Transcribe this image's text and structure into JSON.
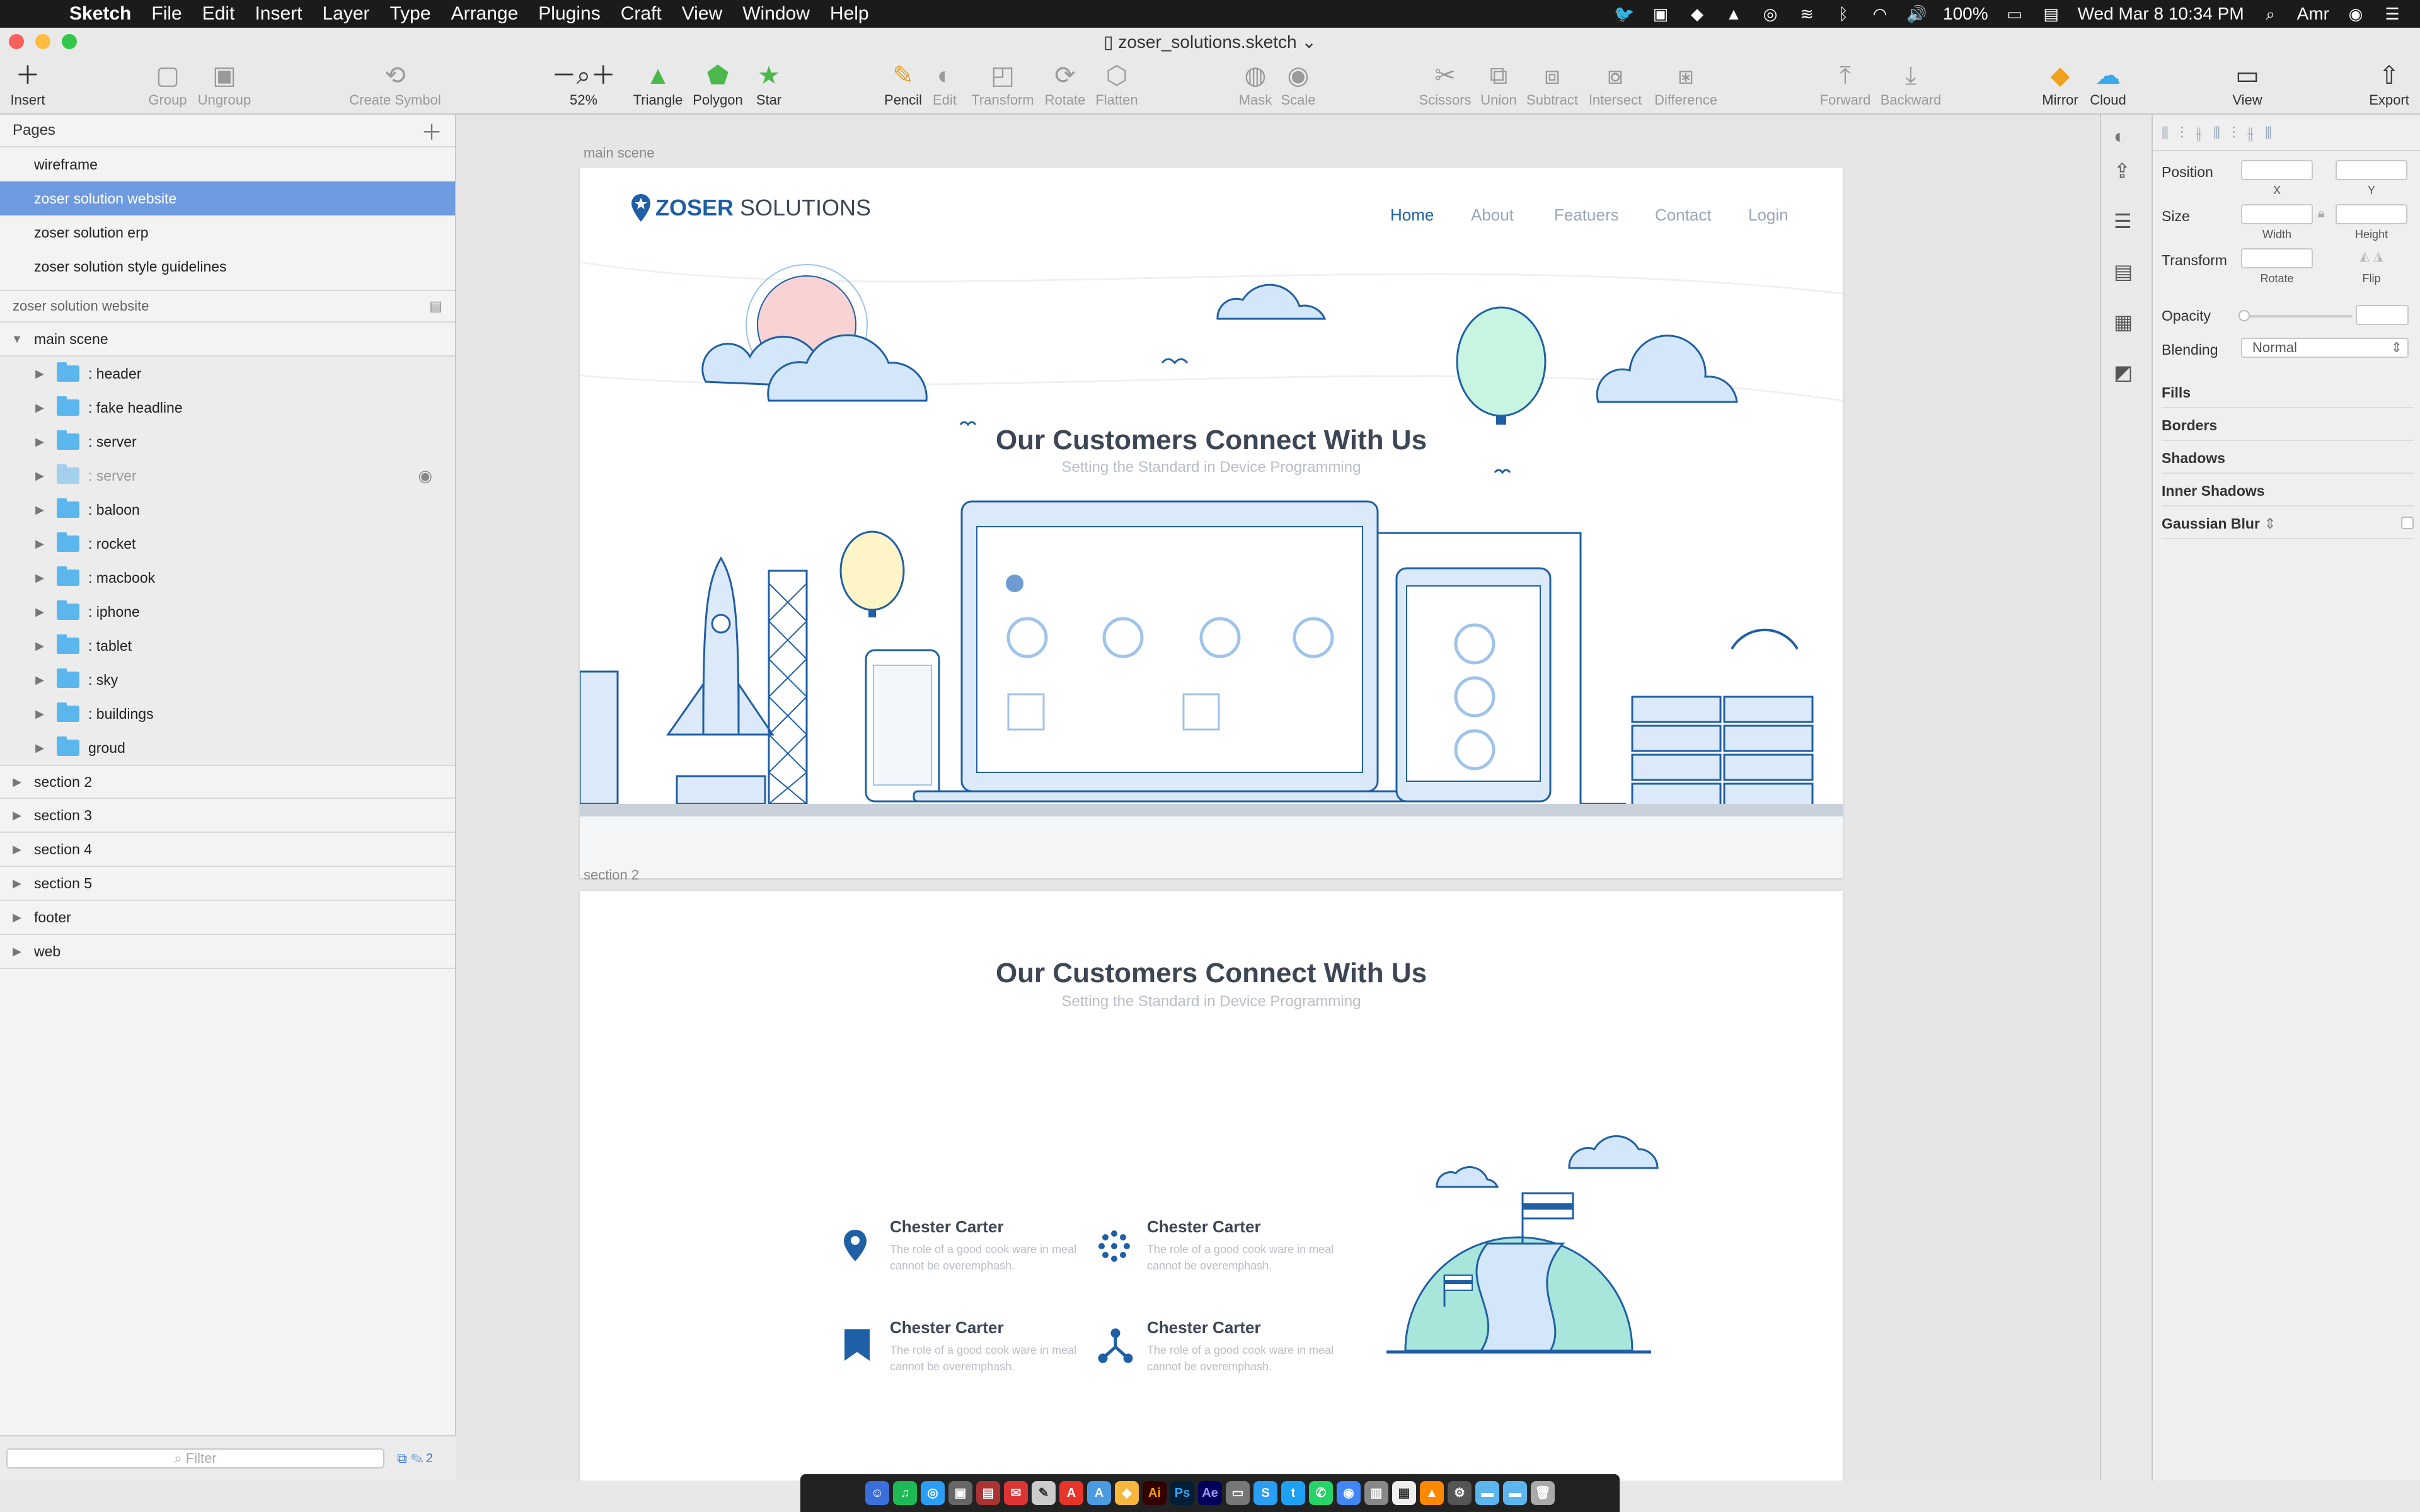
{
  "menubar": {
    "app_name": "Sketch",
    "items": [
      "File",
      "Edit",
      "Insert",
      "Layer",
      "Type",
      "Arrange",
      "Plugins",
      "Craft",
      "View",
      "Window",
      "Help"
    ],
    "battery": "100%",
    "datetime": "Wed Mar 8  10:34 PM",
    "user": "Amr"
  },
  "window": {
    "title": "zoser_solutions.sketch"
  },
  "toolbar": {
    "insert": "Insert",
    "group": "Group",
    "ungroup": "Ungroup",
    "create_symbol": "Create Symbol",
    "zoom": "52%",
    "triangle": "Triangle",
    "polygon": "Polygon",
    "star": "Star",
    "pencil": "Pencil",
    "edit": "Edit",
    "transform": "Transform",
    "rotate": "Rotate",
    "flatten": "Flatten",
    "mask": "Mask",
    "scale": "Scale",
    "scissors": "Scissors",
    "union": "Union",
    "subtract": "Subtract",
    "intersect": "Intersect",
    "difference": "Difference",
    "forward": "Forward",
    "backward": "Backward",
    "mirror": "Mirror",
    "cloud": "Cloud",
    "view": "View",
    "export": "Export"
  },
  "sidebar": {
    "pages_title": "Pages",
    "pages": [
      "wireframe",
      "zoser solution website",
      "zoser solution erp",
      "zoser solution style guidelines"
    ],
    "selected_page": "zoser solution website",
    "layers_title": "zoser solution website",
    "root_layer": "main scene",
    "children": [
      ": header",
      ": fake headline",
      ": server",
      ": server",
      ": baloon",
      ": rocket",
      ": macbook",
      ": iphone",
      ": tablet",
      ": sky",
      ": buildings",
      "groud"
    ],
    "sections": [
      "section 2",
      "section 3",
      "section 4",
      "section 5",
      "footer",
      "web"
    ],
    "filter_placeholder": "Filter",
    "filter_count": "2"
  },
  "canvas": {
    "artboard1_label": "main scene",
    "artboard2_label": "section 2",
    "logo_bold": "ZOSER",
    "logo_light": "SOLUTIONS",
    "nav": [
      "Home",
      "About",
      "Featuers",
      "Contact",
      "Login"
    ],
    "headline": "Our Customers Connect With Us",
    "subheadline": "Setting the Standard in Device Programming",
    "features": [
      {
        "title": "Chester Carter",
        "text": "The role of a good cook ware in meal cannot be overemphash.",
        "icon": "map-pin-icon"
      },
      {
        "title": "Chester Carter",
        "text": "The role of a good cook ware in meal cannot be overemphash.",
        "icon": "dots-cluster-icon"
      },
      {
        "title": "Chester Carter",
        "text": "The role of a good cook ware in meal cannot be overemphash.",
        "icon": "bookmark-icon"
      },
      {
        "title": "Chester Carter",
        "text": "The role of a good cook ware in meal cannot be overemphash.",
        "icon": "network-icon"
      }
    ]
  },
  "inspector": {
    "position": "Position",
    "x": "X",
    "y": "Y",
    "size": "Size",
    "width": "Width",
    "height": "Height",
    "transform": "Transform",
    "rotate": "Rotate",
    "flip": "Flip",
    "opacity": "Opacity",
    "blending": "Blending",
    "blending_value": "Normal",
    "sections": [
      "Fills",
      "Borders",
      "Shadows",
      "Inner Shadows",
      "Gaussian Blur"
    ]
  },
  "colors": {
    "accent": "#1f5fa5",
    "selection": "#6e9be0",
    "folder": "#5cb6ee"
  }
}
